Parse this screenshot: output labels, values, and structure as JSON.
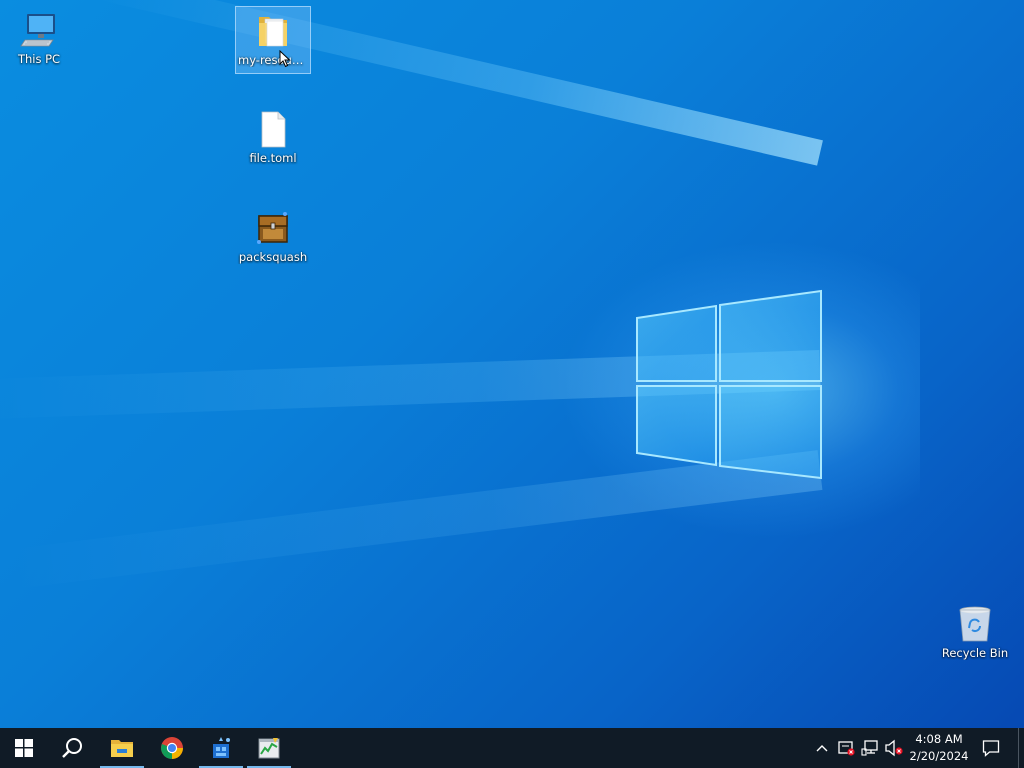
{
  "desktop": {
    "icons": [
      {
        "name": "This PC",
        "icon": "computer-icon",
        "selected": false
      },
      {
        "name": "my-resours...",
        "icon": "folder-icon",
        "selected": true
      },
      {
        "name": "file.toml",
        "icon": "document-icon",
        "selected": false
      },
      {
        "name": "packsquash",
        "icon": "chest-app-icon",
        "selected": false
      },
      {
        "name": "Recycle Bin",
        "icon": "recycle-bin-icon",
        "selected": false
      }
    ]
  },
  "taskbar": {
    "buttons": [
      {
        "name": "Start",
        "icon": "windows-start-icon"
      },
      {
        "name": "Search",
        "icon": "search-icon"
      },
      {
        "name": "File Explorer",
        "icon": "file-explorer-icon",
        "active": true
      },
      {
        "name": "Google Chrome",
        "icon": "chrome-icon",
        "active": false
      },
      {
        "name": "App",
        "icon": "blue-app-icon",
        "active": true
      },
      {
        "name": "Task Manager",
        "icon": "task-manager-icon",
        "active": true
      }
    ],
    "tray": {
      "icons": [
        "chevron-up-icon",
        "security-warning-icon",
        "network-icon",
        "volume-muted-icon"
      ],
      "time": "4:08 AM",
      "date": "2/20/2024",
      "notification_icon": "notification-icon"
    }
  },
  "colors": {
    "wallpaper": "#0a7fd8",
    "taskbar": "#101b26",
    "accent": "#76b9ed"
  }
}
